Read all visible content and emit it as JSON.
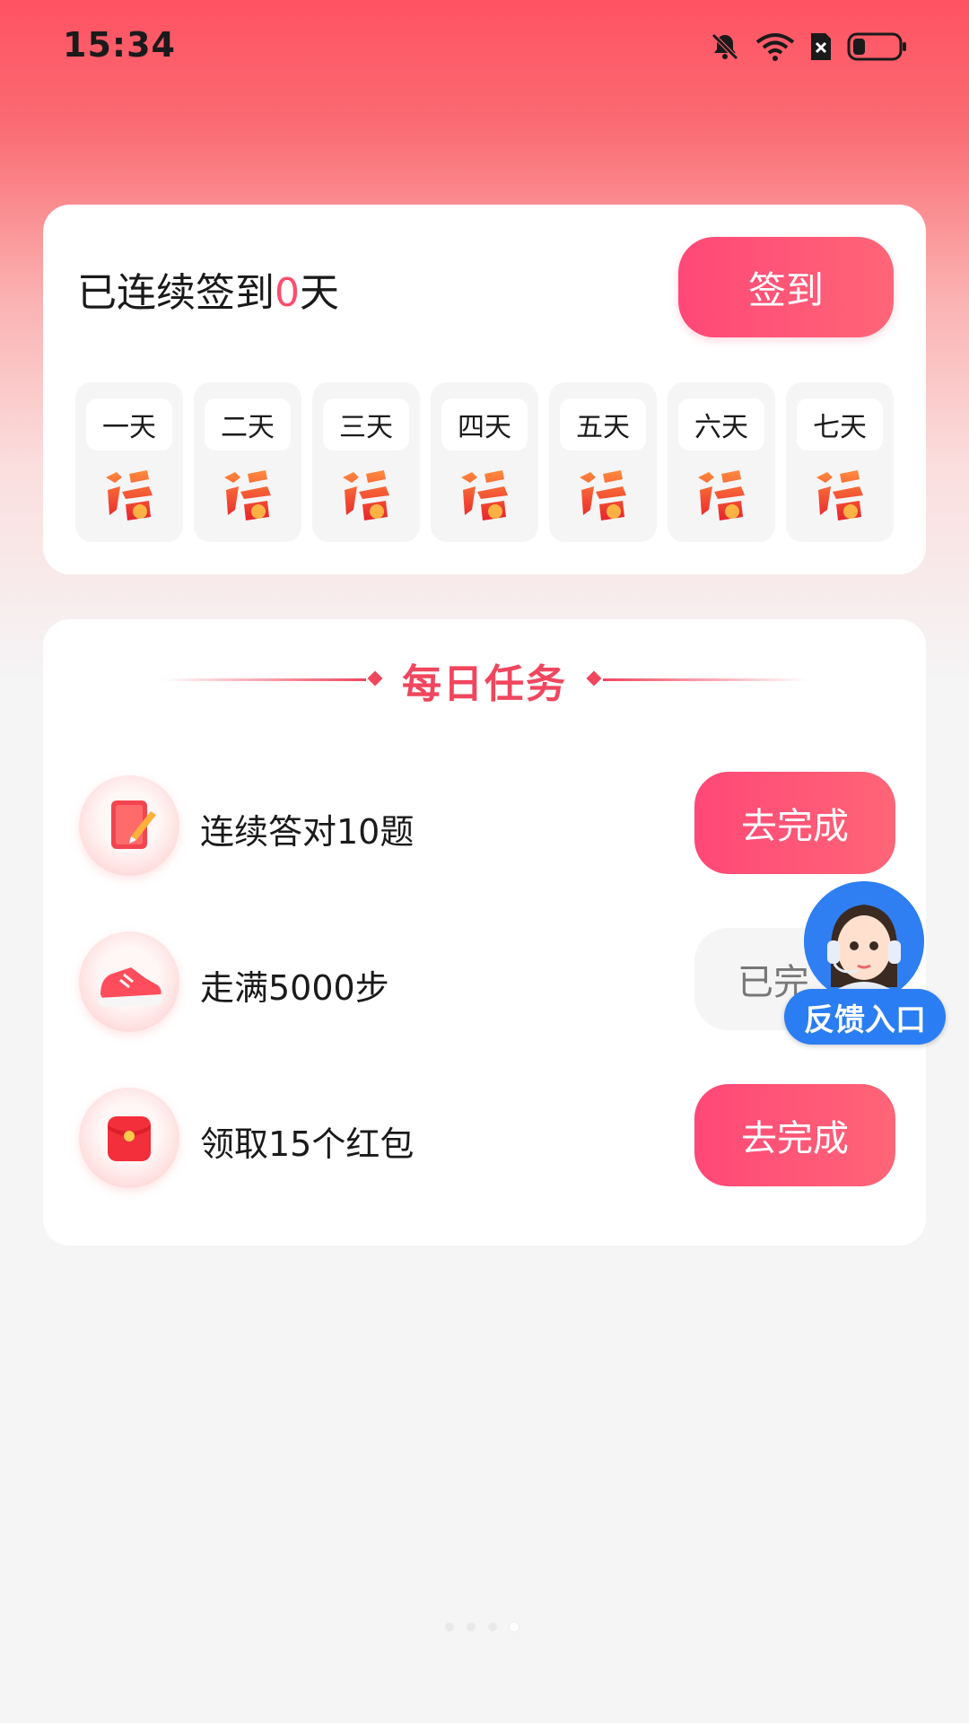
{
  "status_bar": {
    "time": "15:34",
    "icons": [
      "bell-muted-icon",
      "wifi-icon",
      "sim-icon",
      "battery-icon"
    ]
  },
  "checkin": {
    "prefix": "已连续签到",
    "days": "0",
    "suffix": "天",
    "button_label": "签到",
    "days_list": [
      {
        "label": "一天",
        "icon": "fu-icon"
      },
      {
        "label": "二天",
        "icon": "fu-icon"
      },
      {
        "label": "三天",
        "icon": "fu-icon"
      },
      {
        "label": "四天",
        "icon": "fu-icon"
      },
      {
        "label": "五天",
        "icon": "fu-icon"
      },
      {
        "label": "六天",
        "icon": "fu-icon"
      },
      {
        "label": "七天",
        "icon": "fu-icon"
      }
    ]
  },
  "tasks": {
    "title": "每日任务",
    "items": [
      {
        "label": "连续答对10题",
        "button": "去完成",
        "icon": "notebook-icon",
        "state": "todo"
      },
      {
        "label": "走满5000步",
        "button": "已完",
        "icon": "sneaker-icon",
        "state": "done"
      },
      {
        "label": "领取15个红包",
        "button": "去完成",
        "icon": "red-envelope-icon",
        "state": "todo"
      }
    ]
  },
  "feedback": {
    "label": "反馈入口",
    "icon": "support-avatar-icon"
  },
  "pager": {
    "count": 4,
    "active_index": 3
  },
  "colors": {
    "accent": "#ff4d6d",
    "title": "#f0465e",
    "feedback_blue": "#2b7df3"
  }
}
